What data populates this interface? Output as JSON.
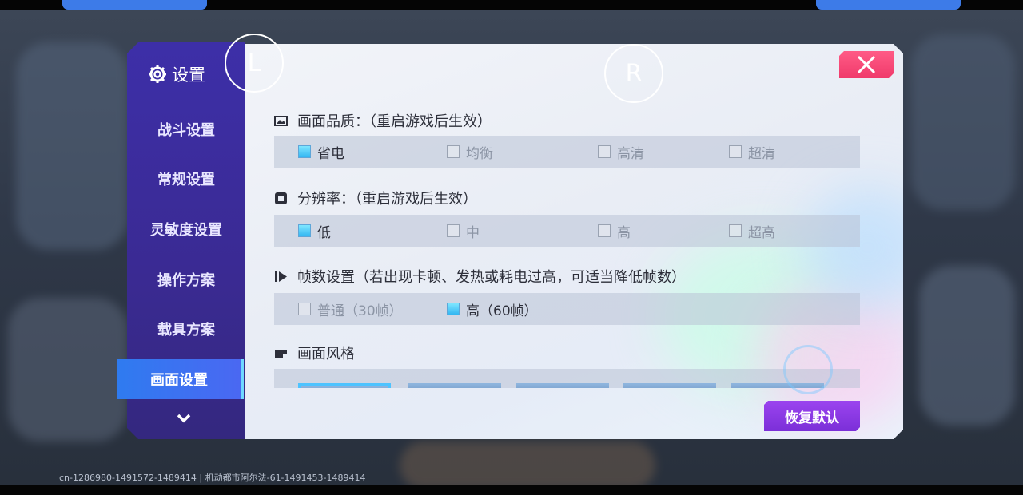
{
  "sidebar": {
    "title": "设置",
    "items": [
      {
        "label": "战斗设置",
        "active": false
      },
      {
        "label": "常规设置",
        "active": false
      },
      {
        "label": "灵敏度设置",
        "active": false
      },
      {
        "label": "操作方案",
        "active": false
      },
      {
        "label": "载具方案",
        "active": false
      },
      {
        "label": "画面设置",
        "active": true
      }
    ]
  },
  "badges": {
    "left": "L",
    "right": "R"
  },
  "sections": {
    "quality": {
      "title": "画面品质：（重启游戏后生效）",
      "options": [
        {
          "label": "省电",
          "checked": true
        },
        {
          "label": "均衡",
          "checked": false
        },
        {
          "label": "高清",
          "checked": false
        },
        {
          "label": "超清",
          "checked": false
        }
      ]
    },
    "resolution": {
      "title": "分辨率：（重启游戏后生效）",
      "options": [
        {
          "label": "低",
          "checked": true
        },
        {
          "label": "中",
          "checked": false
        },
        {
          "label": "高",
          "checked": false
        },
        {
          "label": "超高",
          "checked": false
        }
      ]
    },
    "framerate": {
      "title": "帧数设置（若出现卡顿、发热或耗电过高，可适当降低帧数）",
      "options": [
        {
          "label": "普通（30帧）",
          "checked": false
        },
        {
          "label": "高（60帧）",
          "checked": true
        }
      ]
    },
    "style": {
      "title": "画面风格"
    }
  },
  "reset_label": "恢复默认",
  "version_text": "cn-1286980-1491572-1489414 | 机动都市阿尔法-61-1491453-1489414",
  "colors": {
    "sidebar": "#3a2a92",
    "active_tab": "#2f7bf0",
    "close": "#f03a6b",
    "reset": "#8a38e4",
    "checkbox_on": "#33b6f2"
  }
}
